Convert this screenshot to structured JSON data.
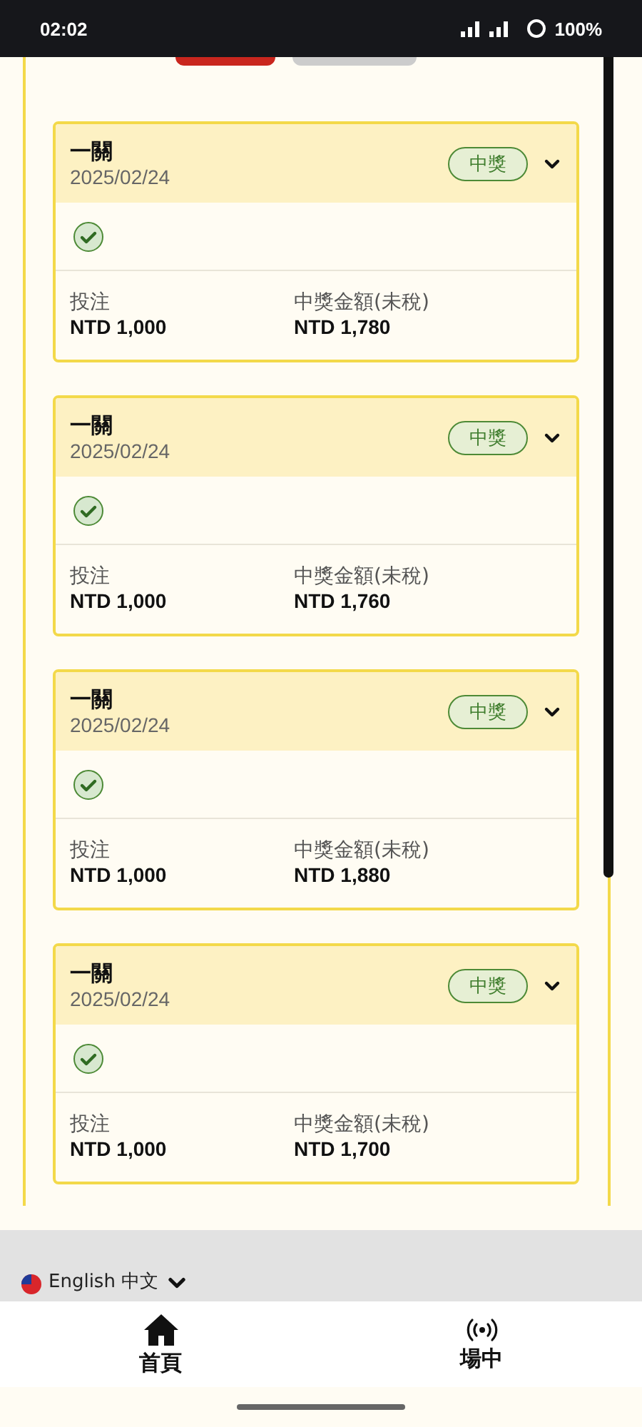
{
  "status_bar": {
    "time": "02:02",
    "battery": "100%"
  },
  "filter_pills": [
    {
      "kind": "active"
    },
    {
      "kind": "inactive"
    }
  ],
  "cards": [
    {
      "title": "一關",
      "date": "2025/02/24",
      "badge": "中獎",
      "won": true,
      "stake_label": "投注",
      "stake": "NTD 1,000",
      "payout_label": "中獎金額(未稅)",
      "payout": "NTD 1,780"
    },
    {
      "title": "一關",
      "date": "2025/02/24",
      "badge": "中獎",
      "won": true,
      "stake_label": "投注",
      "stake": "NTD 1,000",
      "payout_label": "中獎金額(未稅)",
      "payout": "NTD 1,760"
    },
    {
      "title": "一關",
      "date": "2025/02/24",
      "badge": "中獎",
      "won": true,
      "stake_label": "投注",
      "stake": "NTD 1,000",
      "payout_label": "中獎金額(未稅)",
      "payout": "NTD 1,880"
    },
    {
      "title": "一關",
      "date": "2025/02/24",
      "badge": "中獎",
      "won": true,
      "stake_label": "投注",
      "stake": "NTD 1,000",
      "payout_label": "中獎金額(未稅)",
      "payout": "NTD 1,700"
    }
  ],
  "language": {
    "label": "English 中文"
  },
  "nav": [
    {
      "label": "首頁",
      "kind": "home"
    },
    {
      "label": "場中",
      "kind": "live"
    }
  ]
}
